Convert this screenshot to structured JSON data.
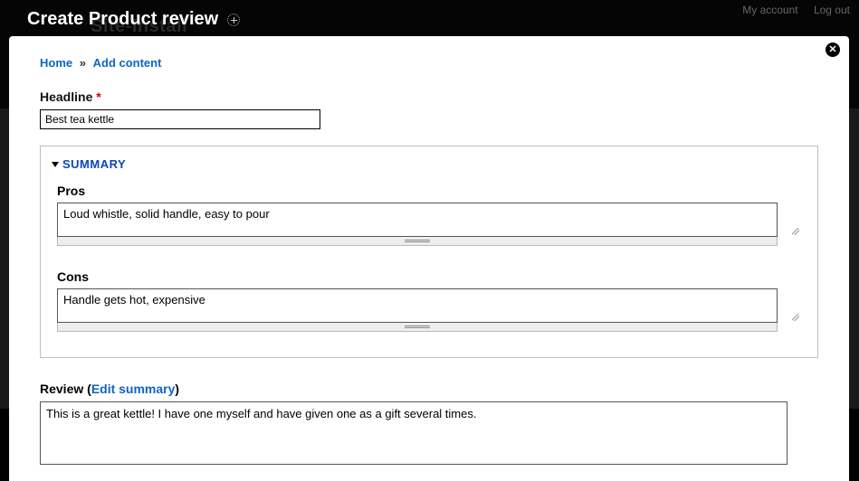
{
  "topnav": {
    "account": "My account",
    "logout": "Log out"
  },
  "brand_faint": "Site-Install",
  "title": "Create Product review",
  "breadcrumb": {
    "home": "Home",
    "sep": "»",
    "add": "Add content"
  },
  "headline": {
    "label": "Headline",
    "required": "*",
    "value": "Best tea kettle"
  },
  "summary": {
    "toggle": "SUMMARY",
    "pros": {
      "label": "Pros",
      "value": "Loud whistle, solid handle, easy to pour"
    },
    "cons": {
      "label": "Cons",
      "value": "Handle gets hot, expensive"
    }
  },
  "review": {
    "label_prefix": "Review (",
    "edit_link": "Edit summary",
    "label_suffix": ")",
    "value": "This is a great kettle! I have one myself and have given one as a gift several times."
  },
  "close_glyph": "✕"
}
